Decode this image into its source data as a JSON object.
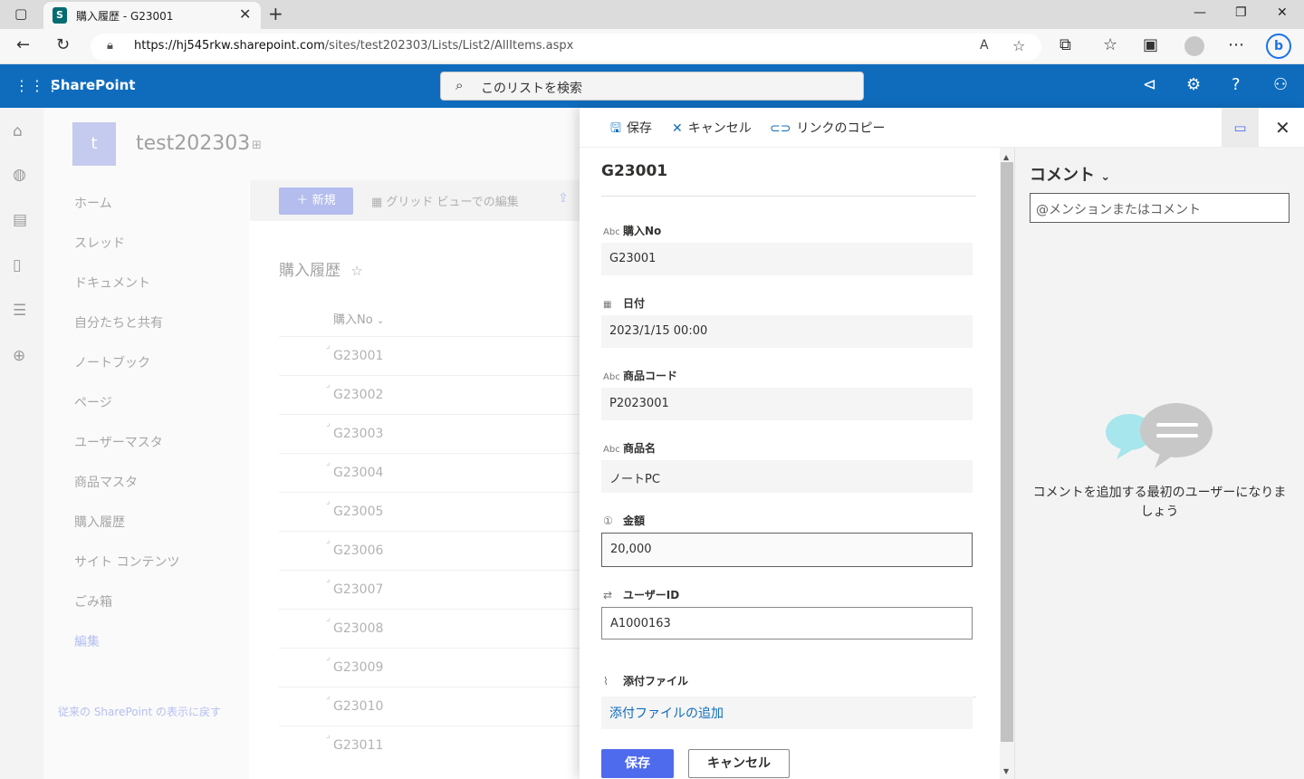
{
  "browser": {
    "tab_title": "購入履歴 - G23001",
    "url_host": "https://hj545rkw.sharepoint.com",
    "url_path": "/sites/test202303/Lists/List2/AllItems.aspx"
  },
  "suite": {
    "brand": "SharePoint",
    "search_placeholder": "このリストを検索"
  },
  "site": {
    "logo_letter": "t",
    "name": "test202303"
  },
  "leftnav": {
    "items": [
      "ホーム",
      "スレッド",
      "ドキュメント",
      "自分たちと共有",
      "ノートブック",
      "ページ",
      "ユーザーマスタ",
      "商品マスタ",
      "購入履歴",
      "サイト コンテンツ",
      "ごみ箱"
    ],
    "edit": "編集",
    "classic": "従来の SharePoint の表示に戻す"
  },
  "commandbar": {
    "new": "新規",
    "grid_edit": "グリッド ビューでの編集"
  },
  "list": {
    "title": "購入履歴",
    "column": "購入No",
    "rows": [
      "G23001",
      "G23002",
      "G23003",
      "G23004",
      "G23005",
      "G23006",
      "G23007",
      "G23008",
      "G23009",
      "G23010",
      "G23011"
    ]
  },
  "panel": {
    "toolbar": {
      "save": "保存",
      "cancel": "キャンセル",
      "copy_link": "リンクのコピー"
    },
    "title": "G23001",
    "fields": {
      "purchase_no": {
        "label": "購入No",
        "value": "G23001"
      },
      "date": {
        "label": "日付",
        "value": "2023/1/15 00:00"
      },
      "product_code": {
        "label": "商品コード",
        "value": "P2023001"
      },
      "product_name": {
        "label": "商品名",
        "value": "ノートPC"
      },
      "amount": {
        "label": "金額",
        "value": "20,000"
      },
      "user_id": {
        "label": "ユーザーID",
        "value": "A1000163"
      },
      "attachments": {
        "label": "添付ファイル",
        "link": "添付ファイルの追加"
      }
    },
    "save_button": "保存",
    "cancel_button": "キャンセル"
  },
  "comments": {
    "title": "コメント",
    "placeholder": "@メンションまたはコメント",
    "empty_text": "コメントを追加する最初のユーザーになりましょう"
  }
}
